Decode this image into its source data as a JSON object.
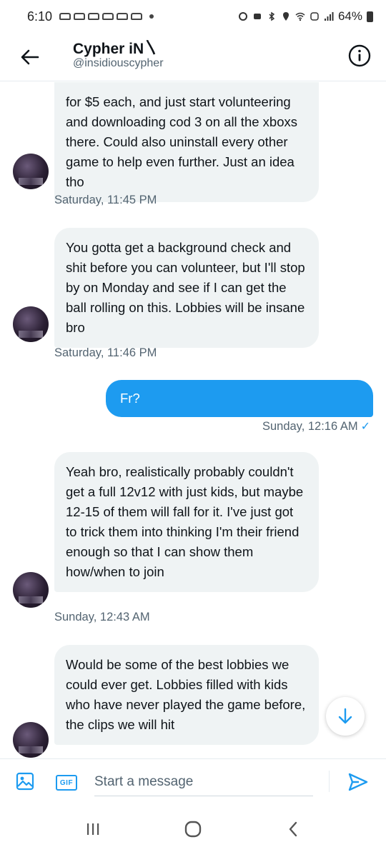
{
  "status_bar": {
    "time": "6:10",
    "battery": "64%"
  },
  "header": {
    "name": "Cypher iN〵",
    "handle": "@insidiouscypher",
    "back_icon": "arrow-left-icon",
    "info_icon": "info-icon"
  },
  "messages": [
    {
      "direction": "in",
      "text": "for $5 each, and just start volunteering and downloading cod 3 on all the xboxs there. Could also uninstall every other game to help even further. Just an idea tho",
      "timestamp": "Saturday, 11:45 PM"
    },
    {
      "direction": "in",
      "text": "You gotta get a background check and shit before you can volunteer, but I'll stop by on Monday and see if I can get the ball rolling on this. Lobbies will be insane bro",
      "timestamp": "Saturday, 11:46 PM"
    },
    {
      "direction": "out",
      "text": "Fr?",
      "timestamp": "Sunday, 12:16 AM"
    },
    {
      "direction": "in",
      "text": "Yeah bro, realistically probably couldn't get a full 12v12 with just kids, but maybe 12-15 of them will fall for it. I've just got to trick them into thinking I'm their friend enough so that I can show them how/when to join",
      "timestamp": "Sunday, 12:43 AM"
    },
    {
      "direction": "in",
      "text": "Would be some of the best lobbies we could ever get. Lobbies filled with kids who have never played the game before, the clips we will hit",
      "timestamp": ""
    }
  ],
  "composer": {
    "placeholder": "Start a message",
    "gif_label": "GIF"
  },
  "colors": {
    "accent": "#1d9bf0",
    "bubble_in": "#eff3f4",
    "muted": "#536471"
  }
}
